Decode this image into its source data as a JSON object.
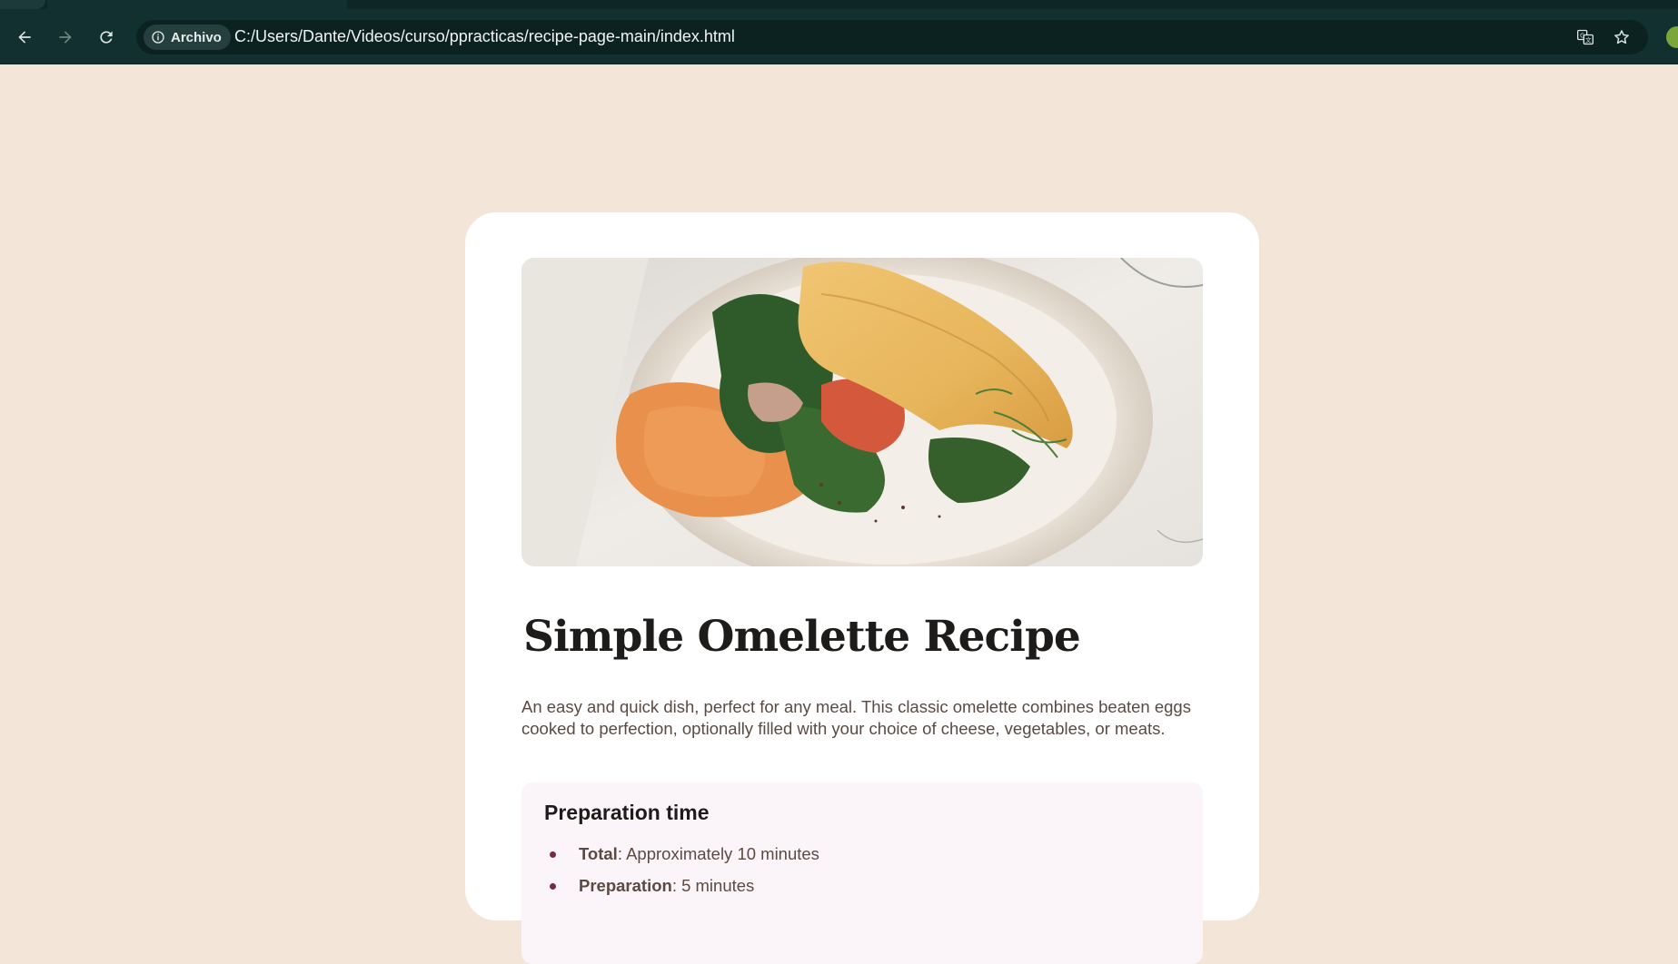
{
  "browser": {
    "security_chip": "Archivo",
    "url": "C:/Users/Dante/Videos/curso/ppracticas/recipe-page-main/index.html",
    "icons": {
      "back": "arrow-left-icon",
      "forward": "arrow-right-icon",
      "reload": "reload-icon",
      "info": "info-icon",
      "translate": "translate-icon",
      "bookmark": "star-icon"
    },
    "theme_color": "#12302f"
  },
  "page": {
    "background": "#f3e6d9",
    "recipe": {
      "title": "Simple Omelette Recipe",
      "intro": "An easy and quick dish, perfect for any meal. This classic omelette combines beaten eggs cooked to perfection, optionally filled with your choice of cheese, vegetables, or meats.",
      "preparation": {
        "heading": "Preparation time",
        "items": [
          {
            "label": "Total",
            "value": ": Approximately 10 minutes"
          },
          {
            "label": "Preparation",
            "value": ": 5 minutes"
          }
        ],
        "bullet_color": "#7a284a"
      }
    }
  }
}
